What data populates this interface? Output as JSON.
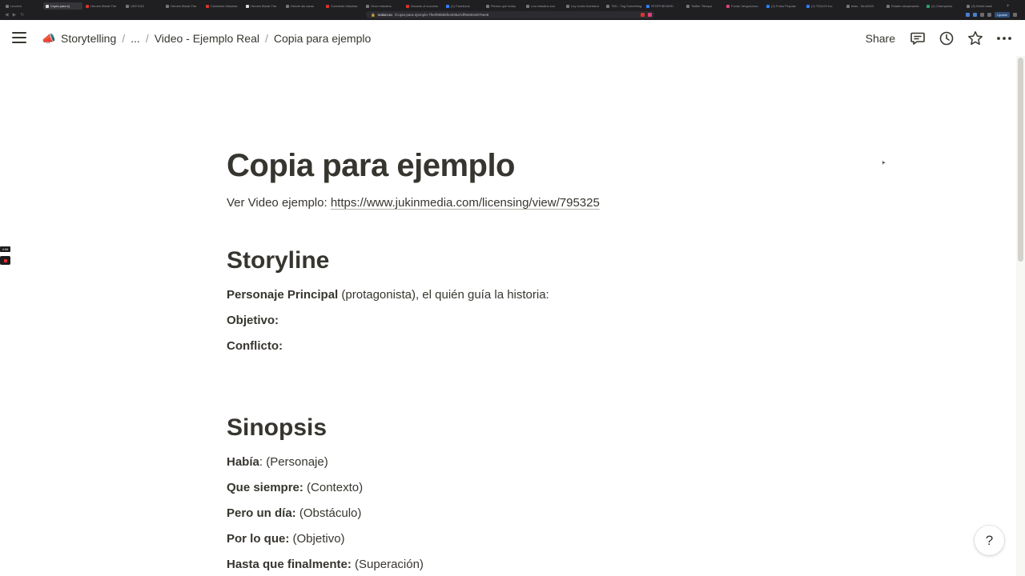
{
  "browser": {
    "tabs": [
      {
        "label": "Lección",
        "fav": "grey"
      },
      {
        "label": "Copia para ej",
        "fav": "notion",
        "active": true
      },
      {
        "label": "Heroes Break The",
        "fav": "red"
      },
      {
        "label": "UNT1012",
        "fav": "grey"
      },
      {
        "label": "Heroes Break The",
        "fav": "grey"
      },
      {
        "label": "Contando historias",
        "fav": "red"
      },
      {
        "label": "Heroes Break The",
        "fav": "notion"
      },
      {
        "label": "Dónde las caras",
        "fav": "grey"
      },
      {
        "label": "Contando historias",
        "fav": "red"
      },
      {
        "label": "Once estudios",
        "fav": "grey"
      },
      {
        "label": "Dreams of success",
        "fav": "red"
      },
      {
        "label": "(1) Facebook",
        "fav": "blue"
      },
      {
        "label": "Pienso que todos",
        "fav": "grey"
      },
      {
        "label": "Los estudios son",
        "fav": "grey"
      },
      {
        "label": "Ley comic Aventura",
        "fav": "grey"
      },
      {
        "label": "TED - Tag Something",
        "fav": "grey"
      },
      {
        "label": "STORYBOARD",
        "fav": "blue"
      },
      {
        "label": "Twitter Tiempo",
        "fav": "grey"
      },
      {
        "label": "Fondo Vergonzoso",
        "fav": "pink"
      },
      {
        "label": "(1) Fotos Propias",
        "fav": "blue"
      },
      {
        "label": "(1) TOUCH Inc",
        "fav": "blue"
      },
      {
        "label": "tesis - 3rro2020",
        "fav": "grey"
      },
      {
        "label": "Estado storyboards",
        "fav": "grey"
      },
      {
        "label": "(1) Champions",
        "fav": "green"
      },
      {
        "label": "(3) World bank",
        "fav": "grey"
      }
    ],
    "url_host": "notion.so",
    "url_path": "/Copia-para-ejemplo-7feef995b8fe4035a7df9e5934876ee8",
    "update_label": "Update"
  },
  "topbar": {
    "breadcrumb": [
      {
        "label": "Storytelling",
        "emoji": "📣"
      },
      {
        "label": "..."
      },
      {
        "label": "Video - Ejemplo Real"
      },
      {
        "label": "Copia para ejemplo"
      }
    ],
    "share_label": "Share",
    "icons": [
      "comment-icon",
      "history-icon",
      "star-icon",
      "more-icon"
    ]
  },
  "recording": {
    "time": "4:06"
  },
  "page": {
    "title": "Copia para ejemplo",
    "video_prefix": "Ver Video ejemplo: ",
    "video_link": "https://www.jukinmedia.com/licensing/view/795325",
    "storyline": {
      "heading": "Storyline",
      "items": [
        {
          "bold": "Personaje Principal",
          "rest": " (protagonista), el quién guía la historia:"
        },
        {
          "bold": "Objetivo:",
          "rest": ""
        },
        {
          "bold": "Conflicto:",
          "rest": ""
        }
      ]
    },
    "sinopsis": {
      "heading": "Sinopsis",
      "items": [
        {
          "bold": "Había",
          "rest": ": (Personaje)"
        },
        {
          "bold": "Que siempre:",
          "rest": " (Contexto)"
        },
        {
          "bold": "Pero un día:",
          "rest": " (Obstáculo)"
        },
        {
          "bold": "Por lo que:",
          "rest": " (Objetivo)"
        },
        {
          "bold": "Hasta que finalmente:",
          "rest": " (Superación)"
        }
      ]
    }
  },
  "help_label": "?"
}
